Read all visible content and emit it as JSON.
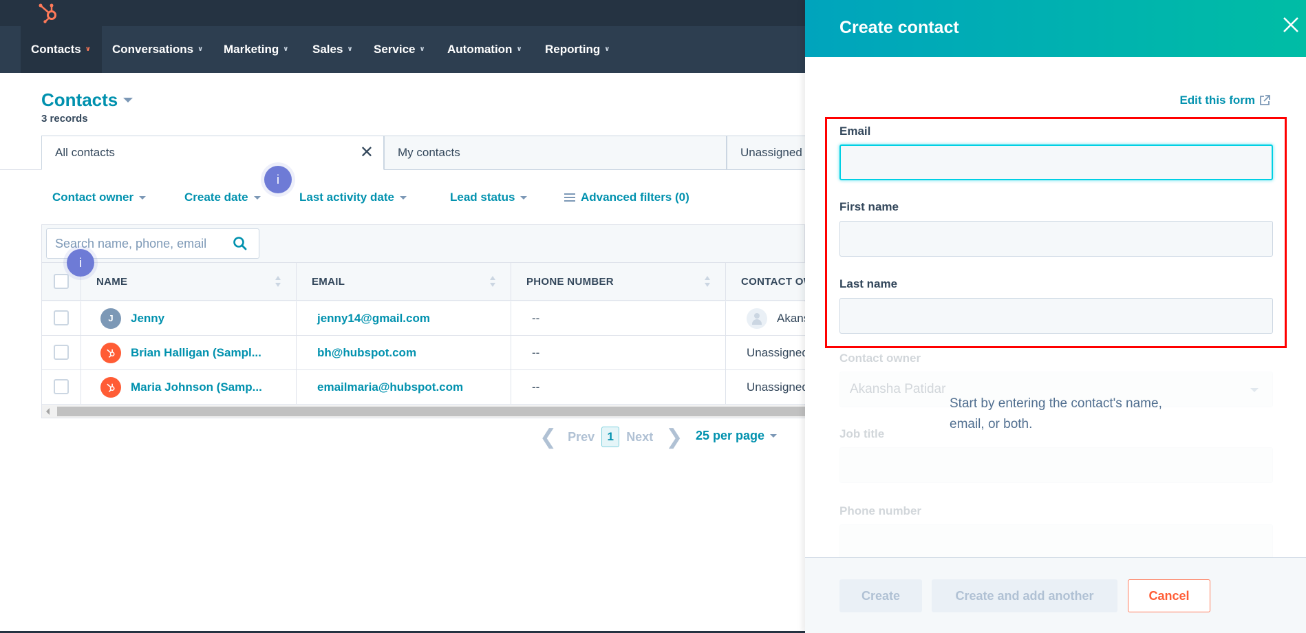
{
  "nav": {
    "items": [
      {
        "label": "Contacts",
        "active": true
      },
      {
        "label": "Conversations"
      },
      {
        "label": "Marketing"
      },
      {
        "label": "Sales"
      },
      {
        "label": "Service"
      },
      {
        "label": "Automation"
      },
      {
        "label": "Reporting"
      }
    ]
  },
  "page": {
    "title": "Contacts",
    "record_count": "3 records"
  },
  "tabs": [
    {
      "label": "All contacts",
      "active": true
    },
    {
      "label": "My contacts"
    },
    {
      "label": "Unassigned"
    }
  ],
  "filters": [
    {
      "label": "Contact owner"
    },
    {
      "label": "Create date"
    },
    {
      "label": "Last activity date"
    },
    {
      "label": "Lead status"
    },
    {
      "label": "Advanced filters (0)"
    }
  ],
  "info_badge": {
    "label": "i"
  },
  "search": {
    "placeholder": "Search name, phone, email"
  },
  "table": {
    "columns": [
      "NAME",
      "EMAIL",
      "PHONE NUMBER",
      "CONTACT OWNER"
    ],
    "rows": [
      {
        "avatar": "J",
        "name": "Jenny",
        "email": "jenny14@gmail.com",
        "phone": "--",
        "owner": "Akansha Patidar"
      },
      {
        "avatar": "hubspot-logo",
        "name": "Brian Halligan (Sampl...",
        "email": "bh@hubspot.com",
        "phone": "--",
        "owner": "Unassigned"
      },
      {
        "avatar": "hubspot-logo",
        "name": "Maria Johnson (Samp...",
        "email": "emailmaria@hubspot.com",
        "phone": "--",
        "owner": "Unassigned"
      }
    ]
  },
  "pagination": {
    "prev": "Prev",
    "current": "1",
    "next": "Next",
    "per_page": "25 per page"
  },
  "panel": {
    "title": "Create contact",
    "edit_form": "Edit this form",
    "fields": {
      "email": {
        "label": "Email",
        "value": ""
      },
      "first_name": {
        "label": "First name",
        "value": ""
      },
      "last_name": {
        "label": "Last name",
        "value": ""
      },
      "contact_owner": {
        "label": "Contact owner",
        "value": "Akansha Patidar"
      },
      "job_title": {
        "label": "Job title",
        "value": ""
      },
      "phone": {
        "label": "Phone number",
        "value": ""
      }
    },
    "hint": "Start by entering the contact's name, email, or both.",
    "buttons": {
      "create": "Create",
      "create_another": "Create and add another",
      "cancel": "Cancel"
    }
  },
  "colors": {
    "brand_orange": "#ff7a59",
    "link_teal": "#0091ae",
    "header_gradient_start": "#00a4bd",
    "header_gradient_end": "#00bda5",
    "nav_dark": "#2d3e50",
    "highlight_red": "#ff0000"
  }
}
